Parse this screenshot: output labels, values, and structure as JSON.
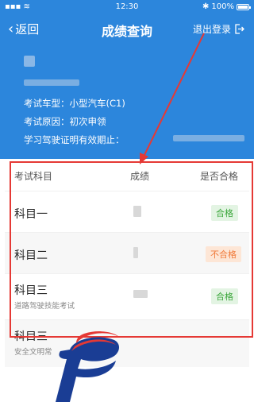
{
  "status_bar": {
    "time": "12:30",
    "battery": "100%",
    "battery_level": 1.0
  },
  "nav": {
    "back_label": "返回",
    "title": "成绩查询",
    "logout_label": "退出登录"
  },
  "info": {
    "vehicle_type": "考试车型：小型汽车(C1)",
    "exam_reason": "考试原因：初次申领",
    "permit_validity": "学习驾驶证明有效期止："
  },
  "table": {
    "headers": {
      "subject": "考试科目",
      "score": "成绩",
      "pass": "是否合格"
    },
    "rows": [
      {
        "subject": "科目一",
        "note": "",
        "result": "合格",
        "status": "pass"
      },
      {
        "subject": "科目二",
        "note": "",
        "result": "不合格",
        "status": "fail"
      },
      {
        "subject": "科目三",
        "note": "道路驾驶技能考试",
        "result": "合格",
        "status": "pass"
      },
      {
        "subject": "科目三",
        "note": "安全文明常",
        "result": "",
        "status": ""
      }
    ]
  },
  "colors": {
    "header_blue": "#2c86dc",
    "annotation_red": "#e53935",
    "pass_green": "#3aa63a",
    "fail_orange": "#f07a3a"
  }
}
